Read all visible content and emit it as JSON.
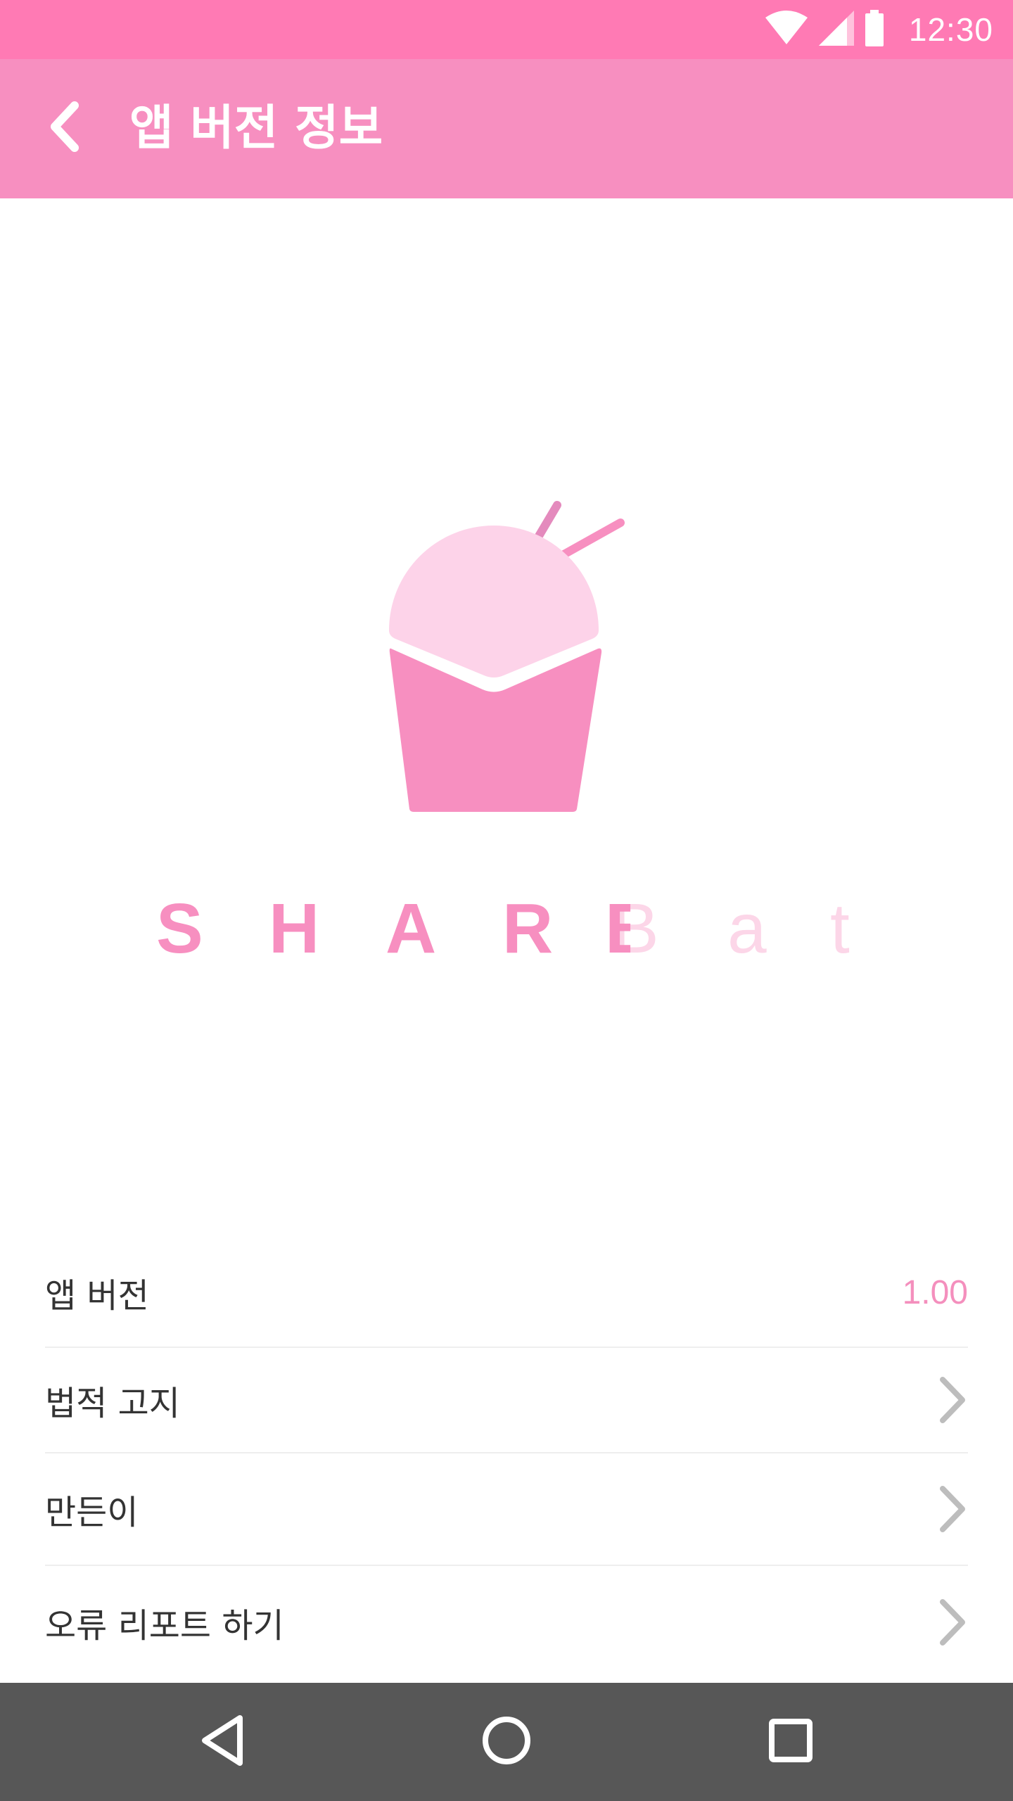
{
  "status_bar": {
    "time": "12:30",
    "icons": [
      "wifi-icon",
      "signal-icon",
      "battery-icon"
    ]
  },
  "app_bar": {
    "title": "앱 버전 정보",
    "back_icon": "arrow-back-icon"
  },
  "logo": {
    "wordmark": [
      "S",
      "H",
      "A",
      "R",
      "B",
      "a",
      "t"
    ]
  },
  "settings": {
    "app_version_label": "앱 버전",
    "app_version_value": "1.00",
    "legal_label": "법적 고지",
    "makers_label": "만든이",
    "bug_report_label": "오류 리포트 하기"
  },
  "nav": {
    "back_icon": "nav-back-icon",
    "home_icon": "nav-home-icon",
    "recents_icon": "nav-recents-icon"
  },
  "colors": {
    "status_bar": "#ff7ab4",
    "app_bar": "#f78fc0",
    "accent": "#f48fbd",
    "logo_light": "#fcd6e8",
    "nav_bar": "#575757"
  }
}
